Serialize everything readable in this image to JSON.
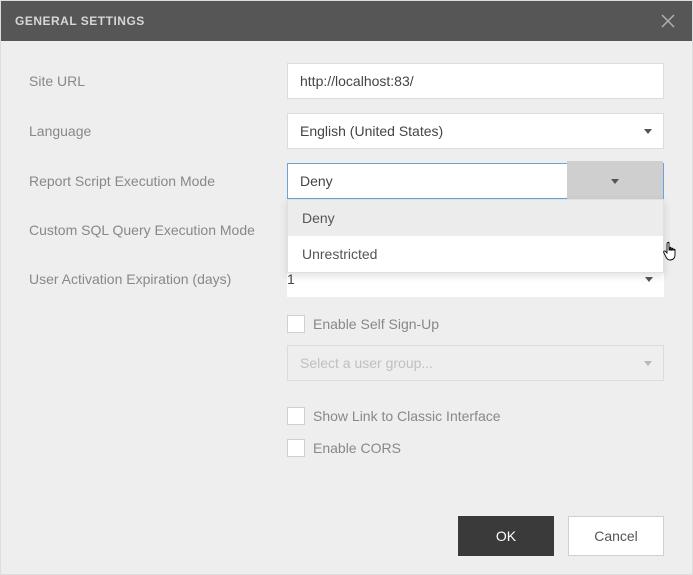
{
  "title": "GENERAL SETTINGS",
  "form": {
    "site_url_label": "Site URL",
    "site_url_value": "http://localhost:83/",
    "language_label": "Language",
    "language_value": "English (United States)",
    "report_mode_label": "Report Script Execution Mode",
    "report_mode_value": "Deny",
    "report_mode_options": [
      "Deny",
      "Unrestricted"
    ],
    "sql_mode_label": "Custom SQL Query Execution Mode",
    "activation_label": "User Activation Expiration (days)",
    "activation_value": "1",
    "enable_signup_label": "Enable Self Sign-Up",
    "user_group_placeholder": "Select a user group...",
    "show_classic_label": "Show Link to Classic Interface",
    "enable_cors_label": "Enable CORS"
  },
  "buttons": {
    "ok": "OK",
    "cancel": "Cancel"
  }
}
